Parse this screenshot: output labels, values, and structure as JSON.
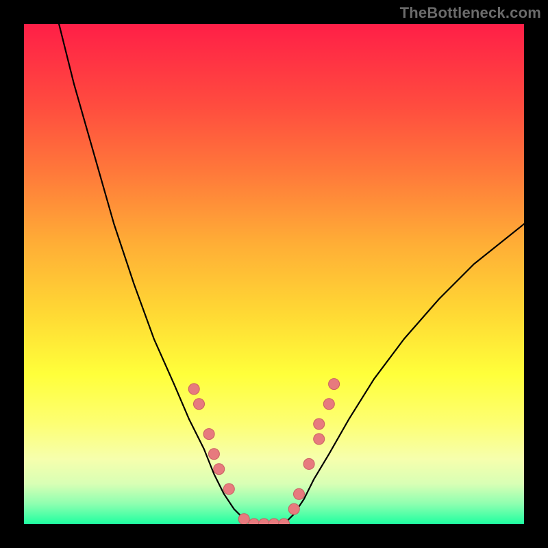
{
  "watermark": "TheBottleneck.com",
  "colors": {
    "frame": "#000000",
    "curve": "#000000",
    "marker_fill": "#e77a7e",
    "marker_stroke": "#c95d61",
    "gradient_stops": [
      "#ff1f47",
      "#ff4b3f",
      "#ff7a3a",
      "#ffae36",
      "#ffd934",
      "#ffff3a",
      "#fdff74",
      "#f6ffad",
      "#d8ffb5",
      "#8dffb0",
      "#1fffa0"
    ]
  },
  "chart_data": {
    "type": "line",
    "title": "",
    "xlabel": "",
    "ylabel": "",
    "xlim": [
      0,
      100
    ],
    "ylim": [
      0,
      100
    ],
    "series": [
      {
        "name": "left-curve",
        "x": [
          7,
          10,
          14,
          18,
          22,
          26,
          30,
          33,
          36,
          38,
          40,
          42,
          44,
          46
        ],
        "y": [
          100,
          88,
          74,
          60,
          48,
          37,
          28,
          21,
          15,
          10,
          6,
          3,
          1,
          0
        ]
      },
      {
        "name": "right-curve",
        "x": [
          52,
          54,
          56,
          58,
          61,
          65,
          70,
          76,
          83,
          90,
          100
        ],
        "y": [
          0,
          2,
          5,
          9,
          14,
          21,
          29,
          37,
          45,
          52,
          60
        ]
      },
      {
        "name": "floor",
        "x": [
          46,
          48,
          50,
          52
        ],
        "y": [
          0,
          0,
          0,
          0
        ]
      }
    ],
    "markers": {
      "name": "dots",
      "points": [
        {
          "x": 34,
          "y": 27
        },
        {
          "x": 35,
          "y": 24
        },
        {
          "x": 37,
          "y": 18
        },
        {
          "x": 38,
          "y": 14
        },
        {
          "x": 39,
          "y": 11
        },
        {
          "x": 41,
          "y": 7
        },
        {
          "x": 44,
          "y": 1
        },
        {
          "x": 46,
          "y": 0
        },
        {
          "x": 48,
          "y": 0
        },
        {
          "x": 50,
          "y": 0
        },
        {
          "x": 52,
          "y": 0
        },
        {
          "x": 54,
          "y": 3
        },
        {
          "x": 55,
          "y": 6
        },
        {
          "x": 57,
          "y": 12
        },
        {
          "x": 59,
          "y": 17
        },
        {
          "x": 59,
          "y": 20
        },
        {
          "x": 61,
          "y": 24
        },
        {
          "x": 62,
          "y": 28
        }
      ]
    }
  }
}
